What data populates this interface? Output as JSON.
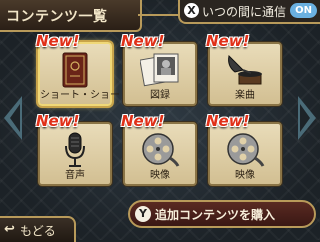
{
  "header": {
    "title": "コンテンツ一覧",
    "notification_button": "X",
    "notification_label": "いつの間に通信",
    "notification_status": "ON"
  },
  "tiles": [
    {
      "new_label": "New!",
      "label": "ショート・ショート",
      "icon": "book-icon"
    },
    {
      "new_label": "New!",
      "label": "図録",
      "icon": "photos-icon"
    },
    {
      "new_label": "New!",
      "label": "楽曲",
      "icon": "gramophone-icon"
    },
    {
      "new_label": "New!",
      "label": "音声",
      "icon": "microphone-icon"
    },
    {
      "new_label": "New!",
      "label": "映像",
      "icon": "film-reel-icon"
    },
    {
      "new_label": "New!",
      "label": "映像",
      "icon": "film-reel-icon"
    }
  ],
  "footer": {
    "back_label": "もどる",
    "buy_button": "Y",
    "buy_label": "追加コンテンツを購入"
  },
  "colors": {
    "accent_gold": "#b89a5a",
    "new_red": "#e03018",
    "on_blue": "#6ab0e0"
  }
}
